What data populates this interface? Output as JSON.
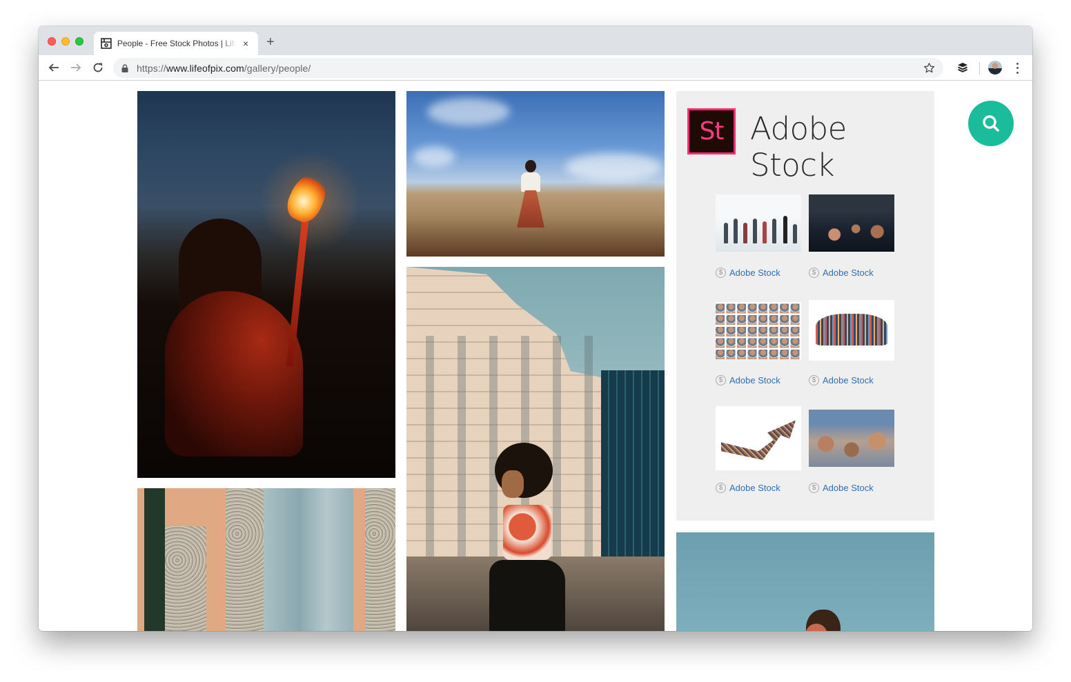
{
  "browser": {
    "tab": {
      "title": "People - Free Stock Photos | Life of Pix",
      "favicon": "lifeofpix-favicon-icon"
    },
    "new_tab_label": "+",
    "close_tab_label": "×",
    "address_bar": {
      "scheme": "https://",
      "host": "www.lifeofpix.com",
      "path": "/gallery/people/"
    },
    "icons": [
      "back-arrow-icon",
      "forward-arrow-icon",
      "reload-icon",
      "lock-icon",
      "bookmark-star-icon",
      "buffer-extension-icon",
      "profile-avatar",
      "more-menu-icon"
    ]
  },
  "gallery": {
    "photos": [
      {
        "id": "torch",
        "description": "Woman holding a lit torch at dusk"
      },
      {
        "id": "field",
        "description": "Woman in red skirt standing in a dry field under blue sky"
      },
      {
        "id": "building",
        "description": "Person with curly hair posing on a rooftop in front of buildings"
      },
      {
        "id": "doors",
        "description": "Peach wall with weathered blue wooden doors"
      },
      {
        "id": "sky",
        "description": "Woman against a blue sky"
      }
    ]
  },
  "ad": {
    "logo_text": "St",
    "title": "Adobe Stock",
    "brand_color": "#ff2b74",
    "items": [
      {
        "thumb": "blurred commuters walking",
        "credit": "Adobe Stock"
      },
      {
        "thumb": "dense crowd on street",
        "credit": "Adobe Stock"
      },
      {
        "thumb": "grid of portrait faces",
        "credit": "Adobe Stock"
      },
      {
        "thumb": "illustrated crowd of people",
        "credit": "Adobe Stock"
      },
      {
        "thumb": "crowd forming upward arrow",
        "credit": "Adobe Stock"
      },
      {
        "thumb": "crowd of people outdoors",
        "credit": "Adobe Stock"
      }
    ],
    "credit_icon": "$"
  },
  "search_fab": {
    "icon": "search-icon",
    "color": "#1bbc9b"
  }
}
